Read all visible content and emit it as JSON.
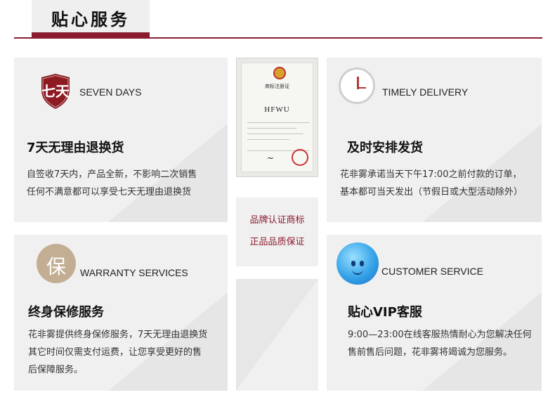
{
  "header": {
    "title": "贴心服务"
  },
  "cards": {
    "seven_days": {
      "badge": "七天",
      "en": "SEVEN DAYS",
      "title": "7天无理由退换货",
      "desc": [
        "自签收7天内，产品全新，不影响二次销售",
        "任何不满意都可以享受七天无理由退换货"
      ]
    },
    "delivery": {
      "en": "TIMELY DELIVERY",
      "title": "及时安排发货",
      "desc": [
        "花非雾承诺当天下午17:00之前付款的订单，",
        "基本都可当天发出（节假日或大型活动除外）"
      ]
    },
    "warranty": {
      "badge": "保",
      "en": "WARRANTY SERVICES",
      "title": "终身保修服务",
      "desc": [
        "花非雾提供终身保修服务，7天无理由退换货",
        "其它时间仅需支付运费，让您享受更好的售",
        "后保障服务。"
      ]
    },
    "customer": {
      "en": "CUSTOMER SERVICE",
      "title": "贴心VIP客服",
      "desc": [
        "9:00—23:00在线客服热情耐心为您解决任何",
        "售前售后问题，花非雾将竭诚为您服务。"
      ]
    }
  },
  "certificate": {
    "heading": "商标注册证",
    "brand": "HFWU"
  },
  "middle": {
    "line1": "品牌认证商标",
    "line2": "正品品质保证"
  },
  "colors": {
    "accent": "#8b1c30",
    "card_bg": "#f0f0f0"
  }
}
